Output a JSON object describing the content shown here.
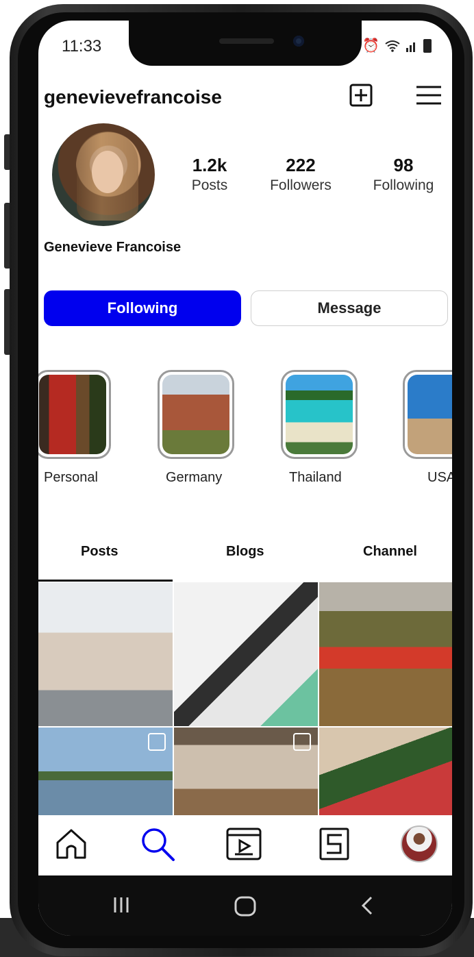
{
  "status_bar": {
    "time": "11:33"
  },
  "profile": {
    "username": "genevievefrancoise",
    "full_name": "Genevieve Francoise",
    "stats": [
      {
        "value": "1.2k",
        "label": "Posts"
      },
      {
        "value": "222",
        "label": "Followers"
      },
      {
        "value": "98",
        "label": "Following"
      }
    ]
  },
  "actions": {
    "following_label": "Following",
    "message_label": "Message"
  },
  "highlights": [
    {
      "label": "Personal"
    },
    {
      "label": "Germany"
    },
    {
      "label": "Thailand"
    },
    {
      "label": "USA"
    }
  ],
  "tabs": [
    {
      "label": "Posts"
    },
    {
      "label": "Blogs"
    },
    {
      "label": "Channel"
    }
  ],
  "nav": {
    "items": [
      "home-icon",
      "search-icon",
      "video-icon",
      "blog-icon",
      "profile-avatar"
    ],
    "active_color": "#0000ee"
  },
  "colors": {
    "accent": "#0000ee"
  }
}
